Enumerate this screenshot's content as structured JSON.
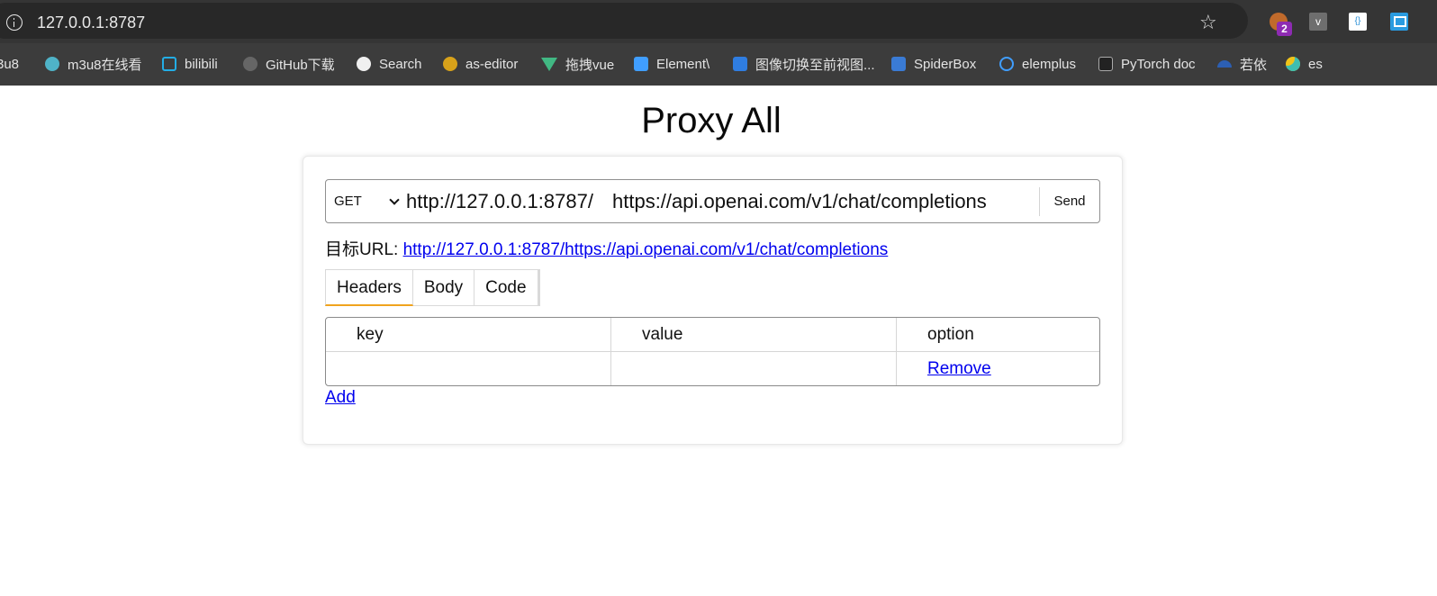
{
  "browser": {
    "address": "127.0.0.1:8787",
    "extensions": [
      {
        "icon": "monkey-extension-icon",
        "badge": "2",
        "color": "#c06a2b"
      },
      {
        "icon": "v-extension-icon",
        "label": "v",
        "color": "#6e6e6e"
      },
      {
        "icon": "json-extension-icon",
        "label": "{}",
        "color": "#ffffff"
      },
      {
        "icon": "window-extension-icon",
        "color": "#2a9be0"
      }
    ],
    "bookmarks": [
      {
        "label": "3u8",
        "icon": "bookmark-partial-icon",
        "color": "#3c3c3c"
      },
      {
        "label": "m3u8在线看",
        "icon": "m3u8-icon",
        "color": "#4fb3c8"
      },
      {
        "label": "bilibili",
        "icon": "bilibili-icon",
        "color": "#23ade5"
      },
      {
        "label": "GitHub下载",
        "icon": "github-icon",
        "color": "#888888"
      },
      {
        "label": "Search",
        "icon": "github-icon",
        "color": "#f0f0f0"
      },
      {
        "label": "as-editor",
        "icon": "as-editor-icon",
        "color": "#d8a21a"
      },
      {
        "label": "拖拽vue",
        "icon": "vue-icon",
        "color": "#41b883"
      },
      {
        "label": "Element\\",
        "icon": "element-icon",
        "color": "#409eff"
      },
      {
        "label": "图像切换至前视图...",
        "icon": "image-app-icon",
        "color": "#2f7de1"
      },
      {
        "label": "SpiderBox",
        "icon": "spiderbox-icon",
        "color": "#3a7bd5"
      },
      {
        "label": "elemplus",
        "icon": "elemplus-icon",
        "color": "#409eff"
      },
      {
        "label": "PyTorch doc",
        "icon": "book-icon",
        "color": "#222222"
      },
      {
        "label": "若依",
        "icon": "ruoyi-icon",
        "color": "#2c5fb3"
      },
      {
        "label": "es",
        "icon": "elastic-icon",
        "color": "#f0c419"
      }
    ]
  },
  "page": {
    "title": "Proxy All",
    "request": {
      "method": "GET",
      "prefix": "http://127.0.0.1:8787/",
      "target": "https://api.openai.com/v1/chat/completions",
      "send_label": "Send"
    },
    "target_url_label": "目标URL: ",
    "target_url": "http://127.0.0.1:8787/https://api.openai.com/v1/chat/completions",
    "tabs": [
      {
        "label": "Headers",
        "active": true
      },
      {
        "label": "Body",
        "active": false
      },
      {
        "label": "Code",
        "active": false
      }
    ],
    "table": {
      "headers": [
        "key",
        "value",
        "option"
      ],
      "rows": [
        {
          "key": "",
          "value": "",
          "option": "Remove"
        }
      ]
    },
    "add_label": "Add",
    "accent_color": "#f0a31e",
    "link_color": "#0000ee"
  }
}
